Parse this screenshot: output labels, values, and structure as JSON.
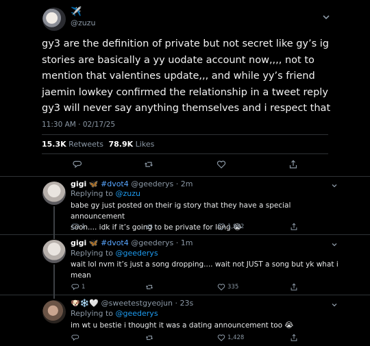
{
  "main_tweet": {
    "display_name_emoji": "✈️",
    "handle": "@zuzu",
    "text": "gy3 are the definition of private but not secret like gy’s ig stories are basically a yy uodate account now,,,, not to mention that valentines update,,, and while yy’s friend jaemin lowkey confirmed the relationship in a tweet reply gy3 will never say anything themselves and i respect that",
    "timestamp": "11:30 AM · 02/17/25",
    "retweets_count": "15.3K",
    "retweets_label": "Retweets",
    "likes_count": "78.9K",
    "likes_label": "Likes"
  },
  "replies": [
    {
      "name": "gigi",
      "name_badges": "🦋 #dvot4",
      "handle": "@geederys",
      "time": "· 2m",
      "replying_prefix": "Replying to",
      "replying_to": "@zuzu",
      "text_line1": "babe gy just posted on their ig story that they have a special announcement",
      "text_line2": "soon.... idk if it’s going to be private for long",
      "text_emoji": "😭",
      "reply_count": "1",
      "like_count": "1,982"
    },
    {
      "name": "gigi",
      "name_badges": "🦋 #dvot4",
      "handle": "@geederys",
      "time": "· 1m",
      "replying_prefix": "Replying to",
      "replying_to": "@geederys",
      "text_line1": "wait lol nvm it’s just a song dropping.... wait not JUST a song but yk what i",
      "text_line2": "mean",
      "reply_count": "1",
      "like_count": "335"
    },
    {
      "name_badges": "🐶❄️🤍",
      "handle": "@sweetestgyeojun",
      "time": "· 23s",
      "replying_prefix": "Replying to",
      "replying_to": "@geederys",
      "text_line1": "im wt u bestie i thought it was a dating announcement too",
      "text_emoji": "😭",
      "like_count": "1,428"
    }
  ],
  "colors": {
    "background": "#000000",
    "mention": "#1d9bf0",
    "secondary_text": "#8b98a5",
    "divider": "#2f3336"
  }
}
